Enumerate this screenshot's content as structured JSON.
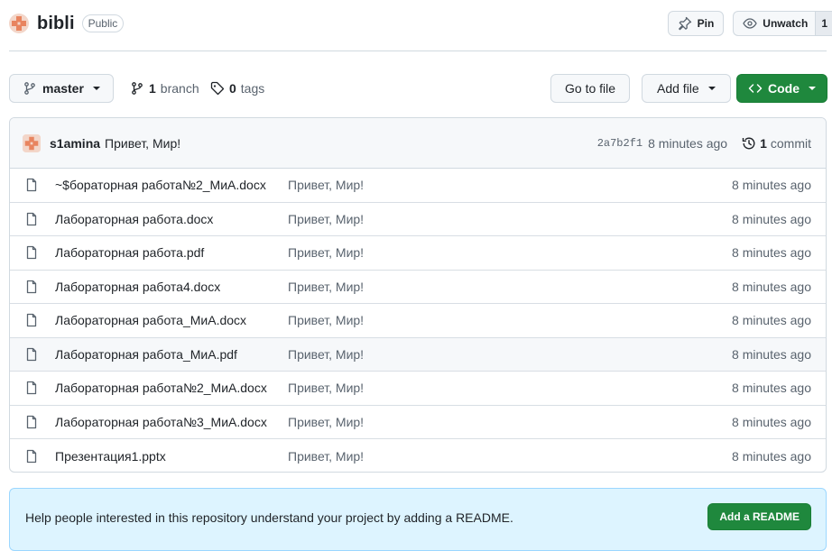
{
  "repo": {
    "name": "bibli",
    "visibility": "Public",
    "pin_label": "Pin",
    "unwatch_label": "Unwatch",
    "watch_count": "1"
  },
  "nav": {
    "branch": "master",
    "branch_count": "1",
    "branch_word": "branch",
    "tag_count": "0",
    "tag_word": "tags",
    "goto_file": "Go to file",
    "add_file": "Add file",
    "code": "Code"
  },
  "commit": {
    "author": "s1amina",
    "message": "Привет, Мир!",
    "hash": "2a7b2f1",
    "time": "8 minutes ago",
    "count": "1",
    "count_word": "commit"
  },
  "files": [
    {
      "name": "~$бораторная работа№2_МиА.docx",
      "message": "Привет, Мир!",
      "time": "8 minutes ago"
    },
    {
      "name": "Лабораторная работа.docx",
      "message": "Привет, Мир!",
      "time": "8 minutes ago"
    },
    {
      "name": "Лабораторная работа.pdf",
      "message": "Привет, Мир!",
      "time": "8 minutes ago"
    },
    {
      "name": "Лабораторная работа4.docx",
      "message": "Привет, Мир!",
      "time": "8 minutes ago"
    },
    {
      "name": "Лабораторная работа_МиА.docx",
      "message": "Привет, Мир!",
      "time": "8 minutes ago"
    },
    {
      "name": "Лабораторная работа_МиА.pdf",
      "message": "Привет, Мир!",
      "time": "8 minutes ago"
    },
    {
      "name": "Лабораторная работа№2_МиА.docx",
      "message": "Привет, Мир!",
      "time": "8 minutes ago"
    },
    {
      "name": "Лабораторная работа№3_МиА.docx",
      "message": "Привет, Мир!",
      "time": "8 minutes ago"
    },
    {
      "name": "Презентация1.pptx",
      "message": "Привет, Мир!",
      "time": "8 minutes ago"
    }
  ],
  "readme": {
    "text": "Help people interested in this repository understand your project by adding a README.",
    "button": "Add a README"
  },
  "colors": {
    "accent_green": "#1f883d",
    "avatar": "#e8845f",
    "banner_bg": "#ddf4ff"
  }
}
